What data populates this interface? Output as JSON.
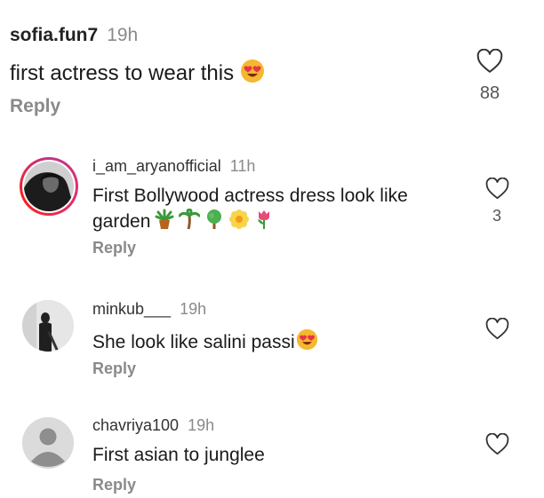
{
  "colors": {
    "text": "#1a1a1a",
    "muted": "#8a8a8a",
    "accent_ring": "#c13584"
  },
  "comments": [
    {
      "username": "sofia.fun7",
      "time": "19h",
      "text": "first actress to wear this",
      "emoji_icons": [
        "heart-eyes-icon"
      ],
      "reply": "Reply",
      "likes": "88"
    },
    {
      "username": "i_am_aryanofficial",
      "time": "11h",
      "text_line1": "First Bollywood actress dress look like",
      "text_line2": "garden",
      "emoji_icons": [
        "potted-plant-icon",
        "palm-tree-icon",
        "deciduous-tree-icon",
        "blossom-icon",
        "tulip-icon"
      ],
      "reply": "Reply",
      "likes": "3"
    },
    {
      "username": "minkub___",
      "time": "19h",
      "text": "She look like salini passi",
      "emoji_icons": [
        "heart-eyes-icon"
      ],
      "reply": "Reply"
    },
    {
      "username": "chavriya100",
      "time": "19h",
      "text": "First asian to junglee",
      "reply": "Reply"
    }
  ]
}
